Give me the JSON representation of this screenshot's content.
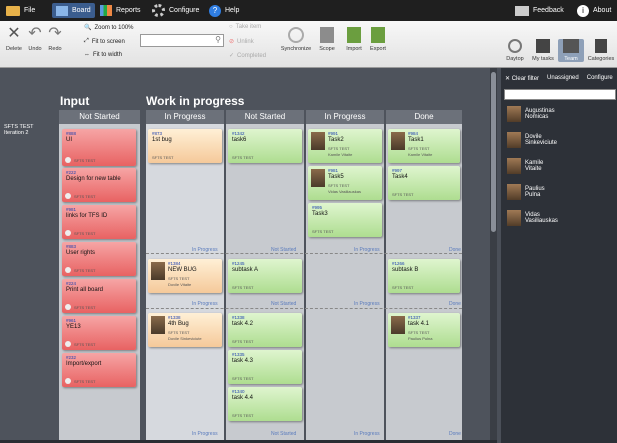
{
  "menu": {
    "file": "File",
    "board": "Board",
    "reports": "Reports",
    "configure": "Configure",
    "help": "Help",
    "feedback": "Feedback",
    "about": "About"
  },
  "ribbon": {
    "delete": "Delete",
    "undo": "Undo",
    "redo": "Redo",
    "zoom100": "Zoom to 100%",
    "fit_screen": "Fit to screen",
    "fit_width": "Fit to width",
    "search_value": "",
    "take_item": "Take item",
    "unlink": "Unlink",
    "completed": "Completed",
    "synchronize": "Synchronize",
    "scope": "Scope",
    "import": "Import",
    "export": "Export",
    "daytop": "Daytop",
    "my_tasks": "My tasks",
    "team": "Team",
    "categories": "Categories"
  },
  "board": {
    "input_title": "Input",
    "wip_title": "Work in progress",
    "lanes": [
      "Not Started",
      "In Progress",
      "Not Started",
      "In Progress",
      "Done"
    ],
    "swimlane": "SFTS TEST\nIteration 2",
    "divider_labels": [
      "In Progress",
      "Not Started",
      "In Progress",
      "Done"
    ],
    "input_cards": [
      {
        "id": "#888",
        "title": "UI",
        "project": "SFTS TEST"
      },
      {
        "id": "#222",
        "title": "Design for new table",
        "project": "SFTS TEST"
      },
      {
        "id": "#981",
        "title": "links for TFS ID",
        "project": "SFTS TEST"
      },
      {
        "id": "#883",
        "title": "User rights",
        "project": "SFTS TEST"
      },
      {
        "id": "#224",
        "title": "Print all board",
        "project": "SFTS TEST"
      },
      {
        "id": "#961",
        "title": "YE13",
        "project": "SFTS TEST"
      },
      {
        "id": "#232",
        "title": "Import/export",
        "project": "SFTS TEST"
      }
    ],
    "wip_inprogress_cards": [
      {
        "id": "#873",
        "title": "1st bug",
        "project": "SFTS TEST",
        "person": ""
      },
      {
        "id": "#1384",
        "title": "NEW BUG",
        "project": "SFTS TEST",
        "person": "Dovile Vitaite"
      },
      {
        "id": "#1338",
        "title": "4th Bug",
        "project": "SFTS TEST",
        "person": "Dovile Sinkeviciute"
      }
    ],
    "task_cards": [
      {
        "id": "#1342",
        "title": "task6",
        "project": "SFTS TEST"
      },
      {
        "id": "#1245",
        "title": "subtask A",
        "project": "SFTS TEST"
      },
      {
        "id": "#1338",
        "title": "task 4.2",
        "project": "SFTS TEST"
      },
      {
        "id": "#1335",
        "title": "task 4.3",
        "project": "SFTS TEST"
      },
      {
        "id": "#1340",
        "title": "task 4.4",
        "project": "SFTS TEST"
      },
      {
        "id": "#991",
        "title": "Task2",
        "project": "SFTS TEST",
        "person": "Kamile Vitaite"
      },
      {
        "id": "#981",
        "title": "Task5",
        "project": "SFTS TEST",
        "person": "Vidas Vasiliauskas"
      },
      {
        "id": "#995",
        "title": "Task3",
        "project": "SFTS TEST"
      },
      {
        "id": "#984",
        "title": "Task1",
        "project": "SFTS TEST",
        "person": "Kamile Vitaite"
      },
      {
        "id": "#997",
        "title": "Task4",
        "project": "SFTS TEST"
      },
      {
        "id": "#1266",
        "title": "subtask B",
        "project": "SFTS TEST"
      },
      {
        "id": "#1337",
        "title": "task 4.1",
        "project": "SFTS TEST",
        "person": "Paulius Pulna"
      }
    ]
  },
  "panel": {
    "clear_filter": "Clear filter",
    "unassigned": "Unassigned",
    "configure": "Configure",
    "users": [
      {
        "first": "Augustinas",
        "last": "Nomicas"
      },
      {
        "first": "Dovile",
        "last": "Sinkeviciute"
      },
      {
        "first": "Kamile",
        "last": "Vitaite"
      },
      {
        "first": "Paulius",
        "last": "Pulna"
      },
      {
        "first": "Vidas",
        "last": "Vasiliauskas"
      }
    ]
  },
  "colors": {
    "accent": "#3b5d8e",
    "red_card": "#e86262",
    "green_card": "#aedd90",
    "tan_card": "#f5c99a"
  }
}
